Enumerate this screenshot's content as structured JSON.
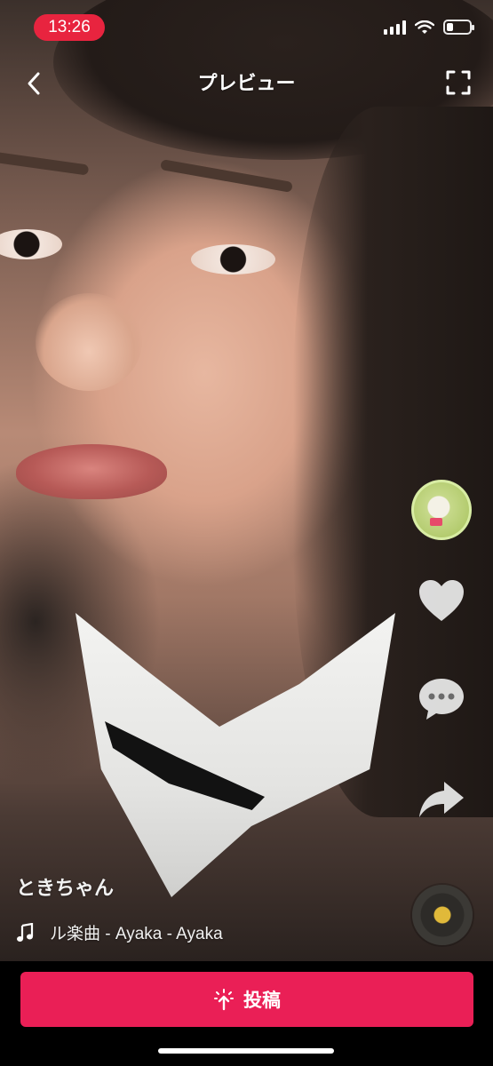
{
  "status_bar": {
    "time": "13:26",
    "signal_icon": "signal-bars-icon",
    "wifi_icon": "wifi-icon",
    "battery_icon": "battery-icon",
    "battery_level": 0.3
  },
  "header": {
    "back_icon": "chevron-left-icon",
    "title": "プレビュー",
    "fullscreen_icon": "fullscreen-icon"
  },
  "rail": {
    "profile_icon": "profile-avatar",
    "like_icon": "heart-icon",
    "comment_icon": "comment-bubble-icon",
    "share_icon": "share-arrow-icon"
  },
  "caption": {
    "username": "ときちゃん",
    "music_icon": "music-note-icon",
    "music": "ル楽曲 - Ayaka - Ayaka",
    "disc_icon": "music-disc-icon"
  },
  "bottom": {
    "post_icon": "sparkle-upload-icon",
    "post_label": "投稿"
  },
  "colors": {
    "accent": "#ea1f56",
    "status_pill": "#e8243f"
  }
}
